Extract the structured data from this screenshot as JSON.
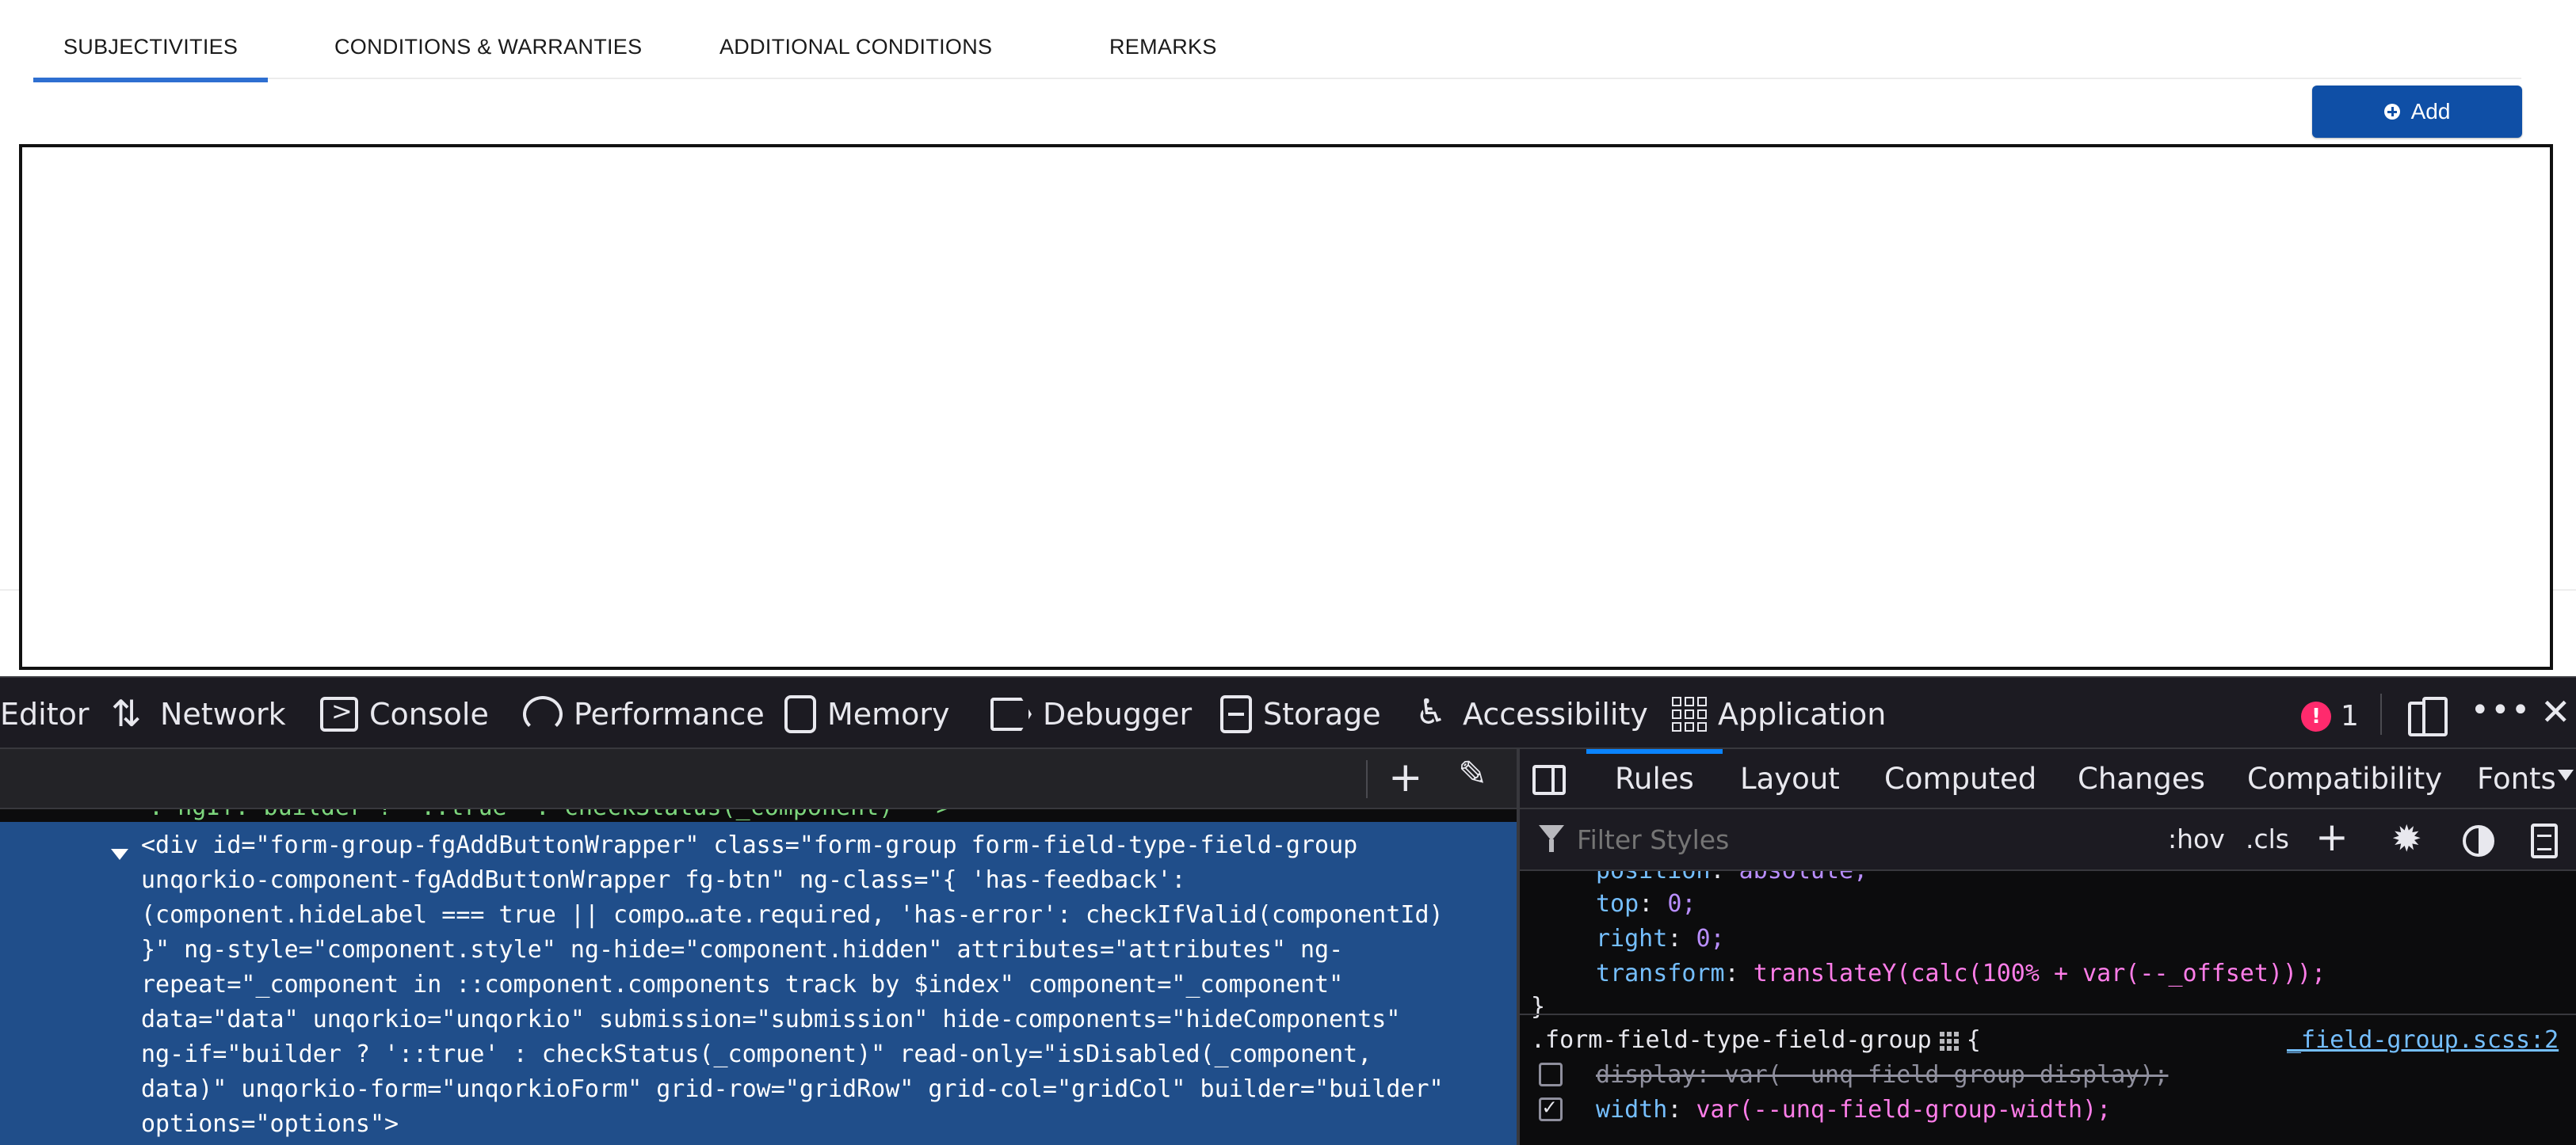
{
  "tabs": [
    {
      "label": "SUBJECTIVITIES",
      "active": true
    },
    {
      "label": "CONDITIONS & WARRANTIES",
      "active": false
    },
    {
      "label": "ADDITIONAL CONDITIONS",
      "active": false
    },
    {
      "label": "REMARKS",
      "active": false
    }
  ],
  "add_button": {
    "label": "Add",
    "icon": "plus-circle-icon",
    "color": "#0f4fa6"
  },
  "devtools": {
    "tools": [
      {
        "label": "Editor",
        "icon": ""
      },
      {
        "label": "Network",
        "icon": "network-icon"
      },
      {
        "label": "Console",
        "icon": "console-icon"
      },
      {
        "label": "Performance",
        "icon": "performance-icon"
      },
      {
        "label": "Memory",
        "icon": "memory-icon"
      },
      {
        "label": "Debugger",
        "icon": "debugger-icon"
      },
      {
        "label": "Storage",
        "icon": "storage-icon"
      },
      {
        "label": "Accessibility",
        "icon": "accessibility-icon"
      },
      {
        "label": "Application",
        "icon": "application-icon"
      }
    ],
    "error_count": "1",
    "error_glyph": "!",
    "html_lines": [
      "<div id=\"form-group-fgAddButtonWrapper\" class=\"form-group form-field-type-field-group",
      "unqorkio-component-fgAddButtonWrapper fg-btn\" ng-class=\"{ 'has-feedback':",
      "(component.hideLabel === true || compo…ate.required, 'has-error': checkIfValid(componentId)",
      "}\" ng-style=\"component.style\" ng-hide=\"component.hidden\" attributes=\"attributes\" ng-",
      "repeat=\"_component in ::component.components track by $index\" component=\"_component\"",
      "data=\"data\" unqorkio=\"unqorkio\" submission=\"submission\" hide-components=\"hideComponents\"",
      "ng-if=\"builder ? '::true' : checkStatus(_component)\" read-only=\"isDisabled(_component,",
      "data)\" unqorkio-form=\"unqorkioForm\" grid-row=\"gridRow\" grid-col=\"gridCol\" builder=\"builder\"",
      "options=\"options\">"
    ],
    "html_cut_line": "\": ngIf: builder ? '::true' : checkStatus(_component) -->",
    "rules_tabs": [
      {
        "label": "Rules",
        "active": true
      },
      {
        "label": "Layout",
        "active": false
      },
      {
        "label": "Computed",
        "active": false
      },
      {
        "label": "Changes",
        "active": false
      },
      {
        "label": "Compatibility",
        "active": false
      },
      {
        "label": "Fonts",
        "active": false
      }
    ],
    "filter_placeholder": "Filter Styles",
    "hov_label": ":hov",
    "cls_label": ".cls",
    "rules": {
      "cut_prop": "position",
      "cut_val": "absolute;",
      "top_prop": "top",
      "top_val": "0;",
      "right_prop": "right",
      "right_val": "0;",
      "transform_prop": "transform",
      "transform_val": "translateY(calc(100% + var(--_offset)));",
      "close_brace": "}",
      "selector": ".form-field-type-field-group",
      "open_brace": "{",
      "source_link": "_field-group.scss:2",
      "decl1": "display: var(--unq-field-group-display);",
      "decl2_prop": "width",
      "decl2_val": "var(--unq-field-group-width);"
    }
  }
}
